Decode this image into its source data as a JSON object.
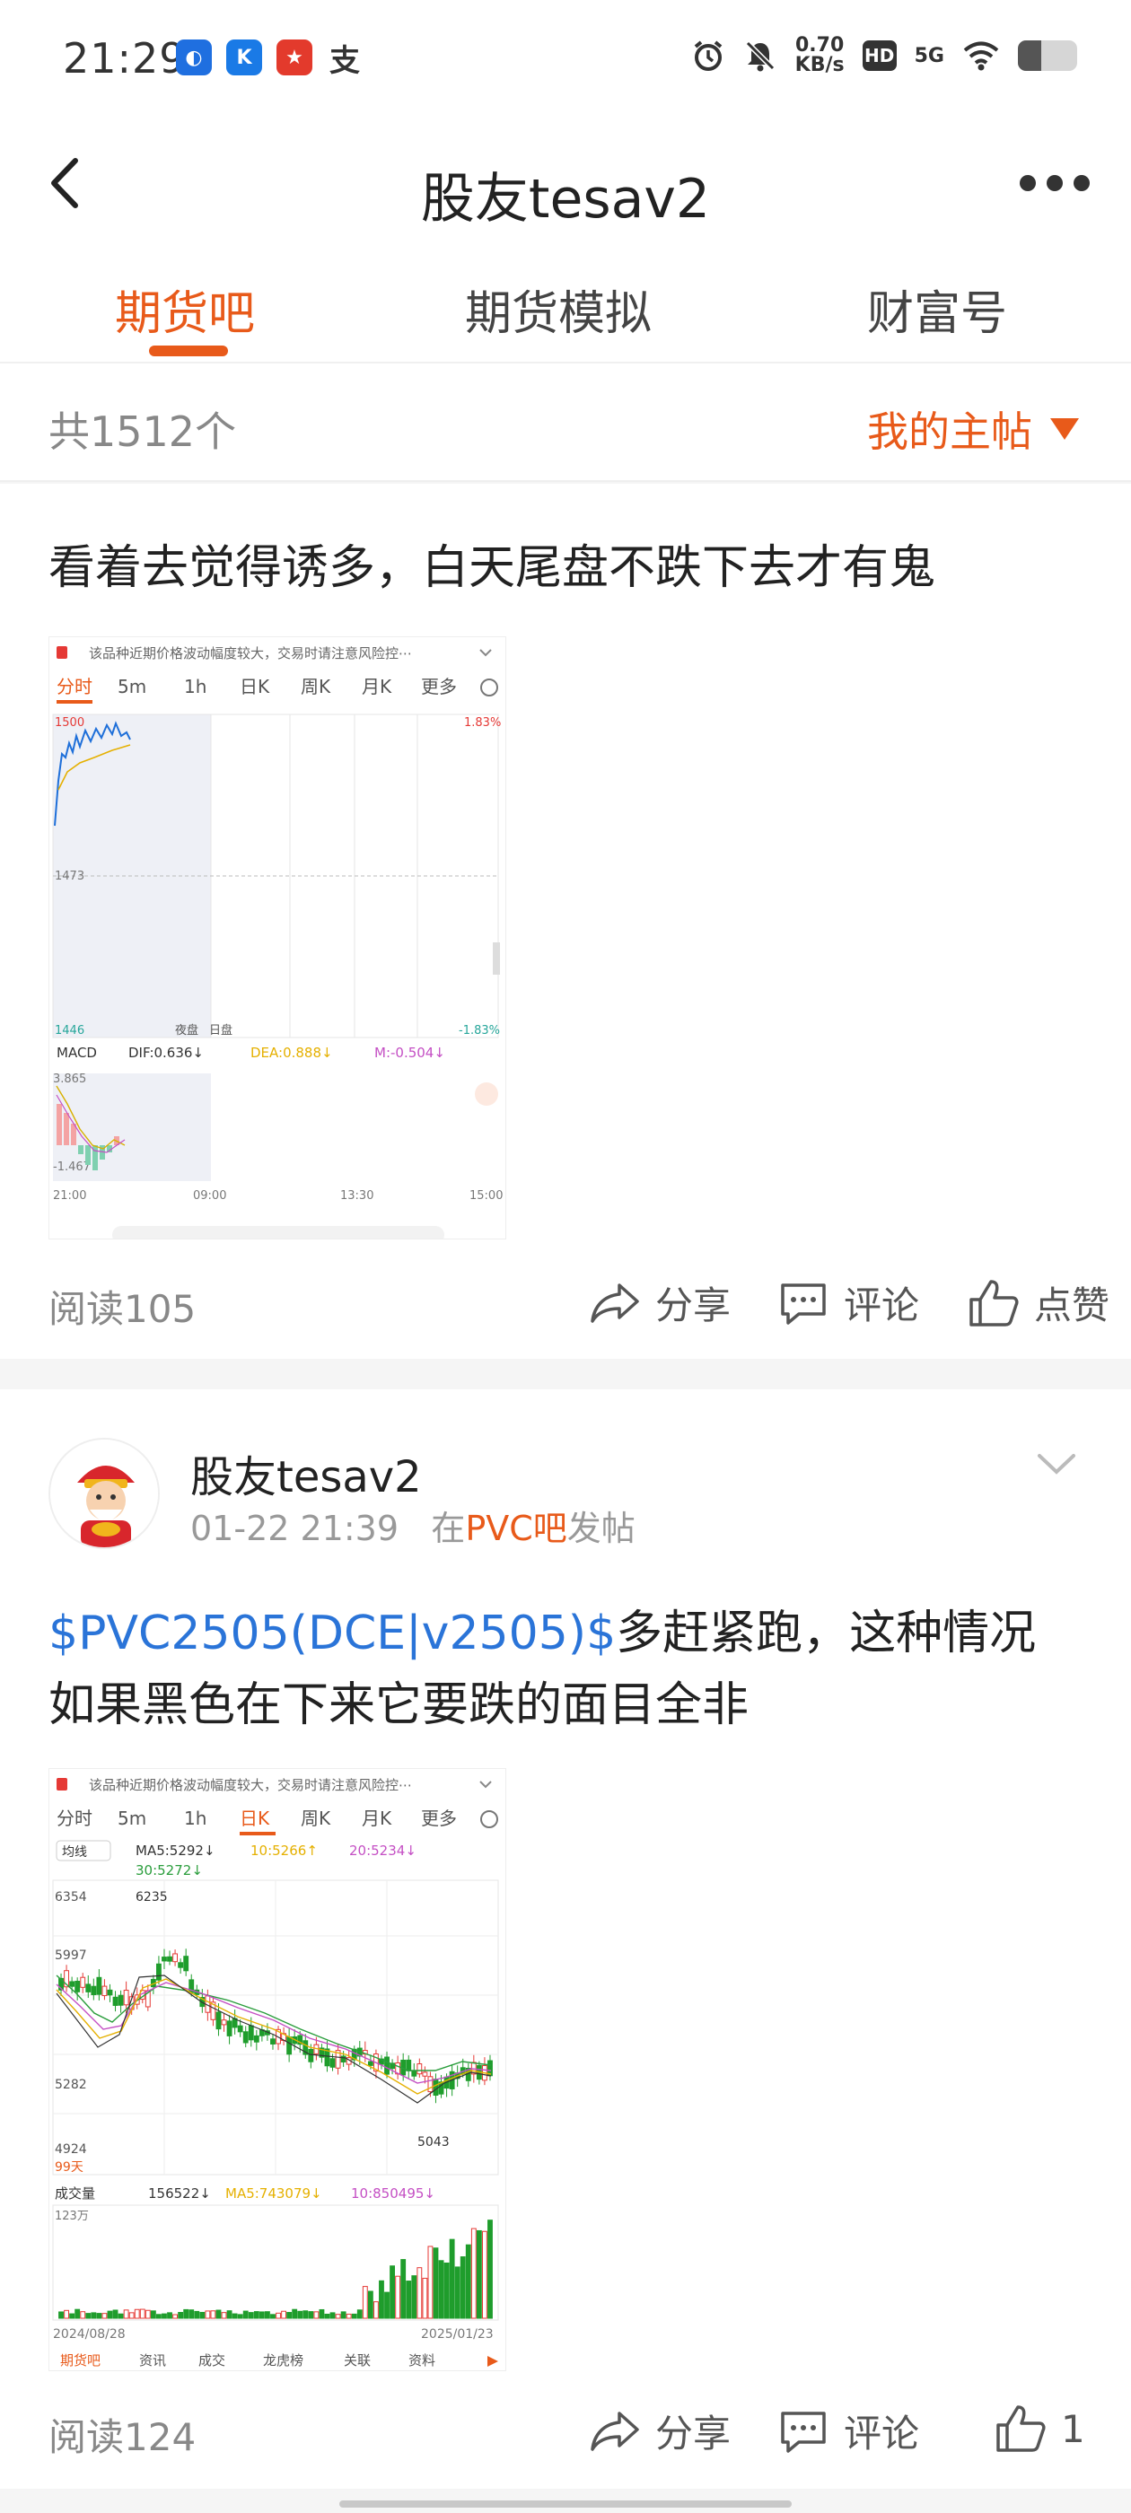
{
  "status_bar": {
    "time": "21:29",
    "net_speed_value": "0.70",
    "net_speed_unit": "KB/s",
    "hd": "HD",
    "network": "5G",
    "icons": [
      "alarm-icon",
      "mute-icon",
      "wifi-icon",
      "battery-icon"
    ],
    "battery_level": 0.4
  },
  "header": {
    "title": "股友tesav2"
  },
  "tabs": [
    {
      "label": "期货吧",
      "active": true
    },
    {
      "label": "期货模拟",
      "active": false
    },
    {
      "label": "财富号",
      "active": false
    }
  ],
  "list_header": {
    "count": "共1512个",
    "filter": "我的主帖"
  },
  "posts": [
    {
      "text": "看着去觉得诱多，白天尾盘不跌下去才有鬼",
      "chart": {
        "warning": "该品种近期价格波动幅度较大，交易时请注意风险控⋯",
        "tabs": [
          "分时",
          "5m",
          "1h",
          "日K",
          "周K",
          "月K",
          "更多"
        ],
        "active_tab": "分时",
        "price_high": "1500",
        "price_mid": "1473",
        "price_low": "1446",
        "pct_high": "1.83%",
        "pct_low": "-1.83%",
        "session_labels": [
          "夜盘",
          "日盘"
        ],
        "macd_label": "MACD",
        "dif": "DIF:0.636↓",
        "dea": "DEA:0.888↓",
        "m": "M:-0.504↓",
        "macd_high": "3.865",
        "macd_low": "-1.467",
        "times": [
          "21:00",
          "09:00",
          "13:30",
          "15:00"
        ]
      },
      "reads": "阅读105",
      "actions": {
        "share": "分享",
        "comment": "评论",
        "like": "点赞"
      }
    },
    {
      "author": "股友tesav2",
      "date": "01-22 21:39",
      "meta_prefix": "在",
      "bar_name": "PVC吧",
      "meta_suffix": "发帖",
      "stock_link": "$PVC2505(DCE|v2505)$",
      "text": "多赶紧跑，这种情况如果黑色在下来它要跌的面目全非",
      "chart": {
        "warning": "该品种近期价格波动幅度较大，交易时请注意风险控⋯",
        "tabs": [
          "分时",
          "5m",
          "1h",
          "日K",
          "周K",
          "月K",
          "更多"
        ],
        "active_tab": "日K",
        "ma_label": "均线",
        "ma5": "MA5:5292↓",
        "ma10": "10:5266↑",
        "ma20": "20:5234↓",
        "ma30": "30:5272↓",
        "price_high": "6354",
        "price_peak": "6235",
        "price_2": "5997",
        "price_3": "5282",
        "price_low": "4924",
        "price_trough": "5043",
        "days": "99天",
        "vol_label": "成交量",
        "vol": "156522↓",
        "vol_ma5": "MA5:743079↓",
        "vol_ma10": "10:850495↓",
        "vol_max": "123万",
        "date_start": "2024/08/28",
        "date_end": "2025/01/23",
        "bottom_tabs": [
          "期货吧",
          "资讯",
          "成交",
          "龙虎榜",
          "关联",
          "资料"
        ]
      },
      "reads": "阅读124",
      "actions": {
        "share": "分享",
        "comment": "评论",
        "like": "1"
      }
    }
  ],
  "colors": {
    "accent": "#e85a1a",
    "link": "#2a74d8",
    "muted": "#888888"
  }
}
